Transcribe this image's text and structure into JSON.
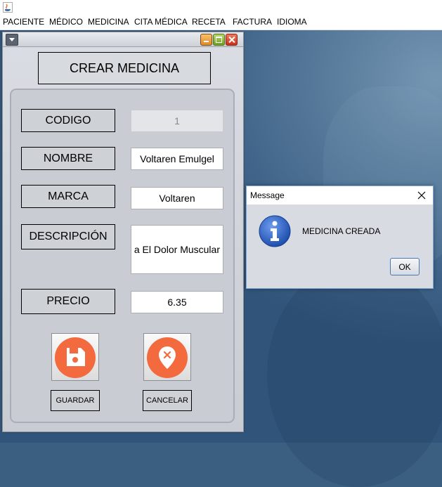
{
  "menubar": {
    "items": [
      "PACIENTE",
      "MÉDICO",
      "MEDICINA",
      "CITA MÉDICA",
      "RECETA",
      "FACTURA",
      "IDIOMA"
    ]
  },
  "form": {
    "title": "CREAR MEDICINA",
    "codigo_label": "CODIGO",
    "codigo_value": "1",
    "nombre_label": "NOMBRE",
    "nombre_value": "Voltaren Emulgel",
    "marca_label": "MARCA",
    "marca_value": "Voltaren",
    "descripcion_label": "DESCRIPCIÓN",
    "descripcion_value": "a El Dolor Muscular",
    "precio_label": "PRECIO",
    "precio_value": "6.35",
    "guardar_label": "GUARDAR",
    "cancelar_label": "CANCELAR"
  },
  "dialog": {
    "title": "Message",
    "message": "MEDICINA CREADA",
    "ok_label": "OK"
  },
  "colors": {
    "accent_orange": "#f26a3d",
    "desktop_blue": "#3b5f80",
    "dialog_border": "#7ea6d6",
    "info_blue": "#2f62c4"
  },
  "icons": [
    "java-app-icon",
    "floppy-disk-icon",
    "cancel-pin-icon",
    "info-icon",
    "close-icon"
  ]
}
